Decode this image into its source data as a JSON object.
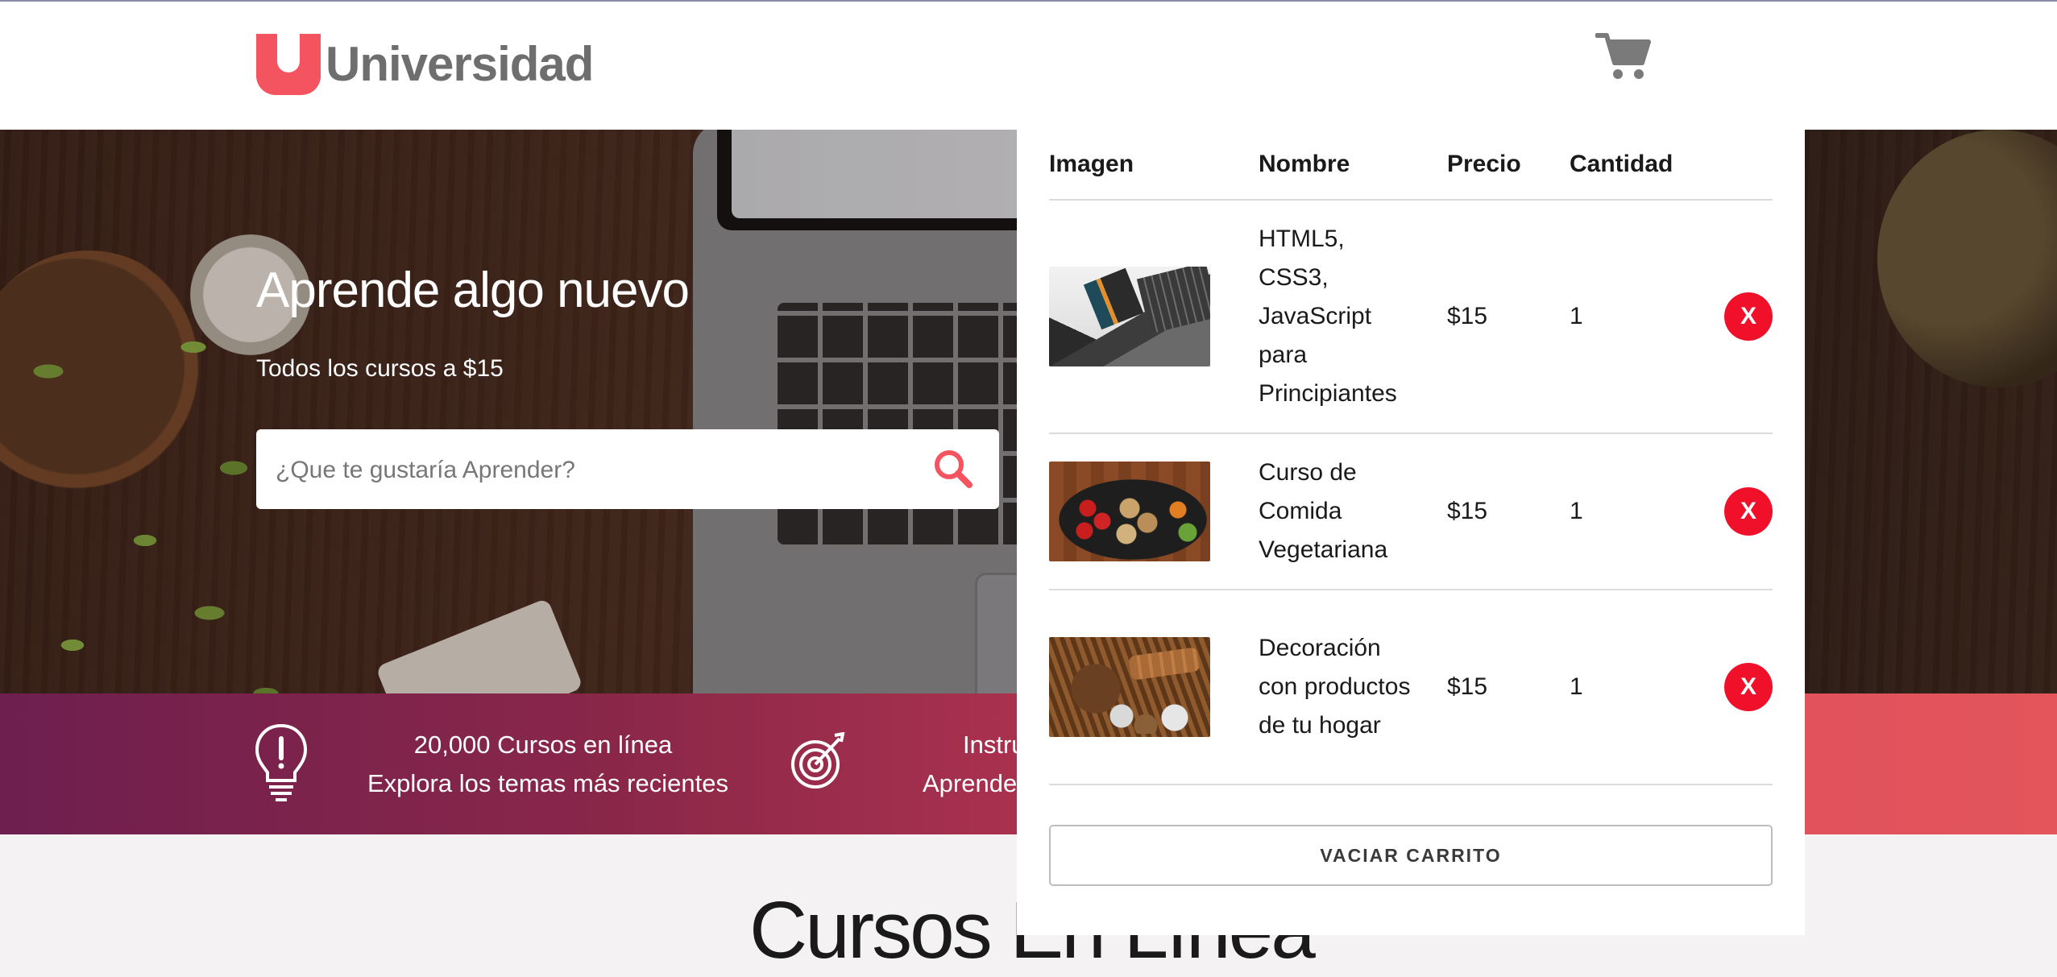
{
  "header": {
    "logo_text": "Universidad",
    "cart_icon": "shopping-cart-icon"
  },
  "hero": {
    "title": "Aprende algo nuevo",
    "subtitle": "Todos los cursos a $15",
    "search": {
      "placeholder": "¿Que te gustaría Aprender?",
      "value": "",
      "icon": "search-icon"
    }
  },
  "info_bar": {
    "items": [
      {
        "icon": "lightbulb-icon",
        "line1": "20,000 Cursos en línea",
        "line2": "Explora los temas más recientes"
      },
      {
        "icon": "target-icon",
        "line1": "Instru",
        "line2": "Aprende"
      }
    ]
  },
  "section": {
    "title": "Cursos En Línea"
  },
  "cart": {
    "columns": [
      "Imagen",
      "Nombre",
      "Precio",
      "Cantidad"
    ],
    "items": [
      {
        "name": "HTML5, CSS3, JavaScript para Principiantes",
        "price": "$15",
        "quantity": "1",
        "remove_label": "X",
        "image": "course-html-thumbnail"
      },
      {
        "name": "Curso de Comida Vegetariana",
        "price": "$15",
        "quantity": "1",
        "remove_label": "X",
        "image": "course-food-thumbnail"
      },
      {
        "name": "Decoración con productos de tu hogar",
        "price": "$15",
        "quantity": "1",
        "remove_label": "X",
        "image": "course-decor-thumbnail"
      }
    ],
    "empty_button": "VACIAR CARRITO"
  },
  "colors": {
    "brand": "#f4545f",
    "remove_button": "#f0102a",
    "info_bar_start": "#6e1f4f",
    "info_bar_end": "#e3545b"
  }
}
